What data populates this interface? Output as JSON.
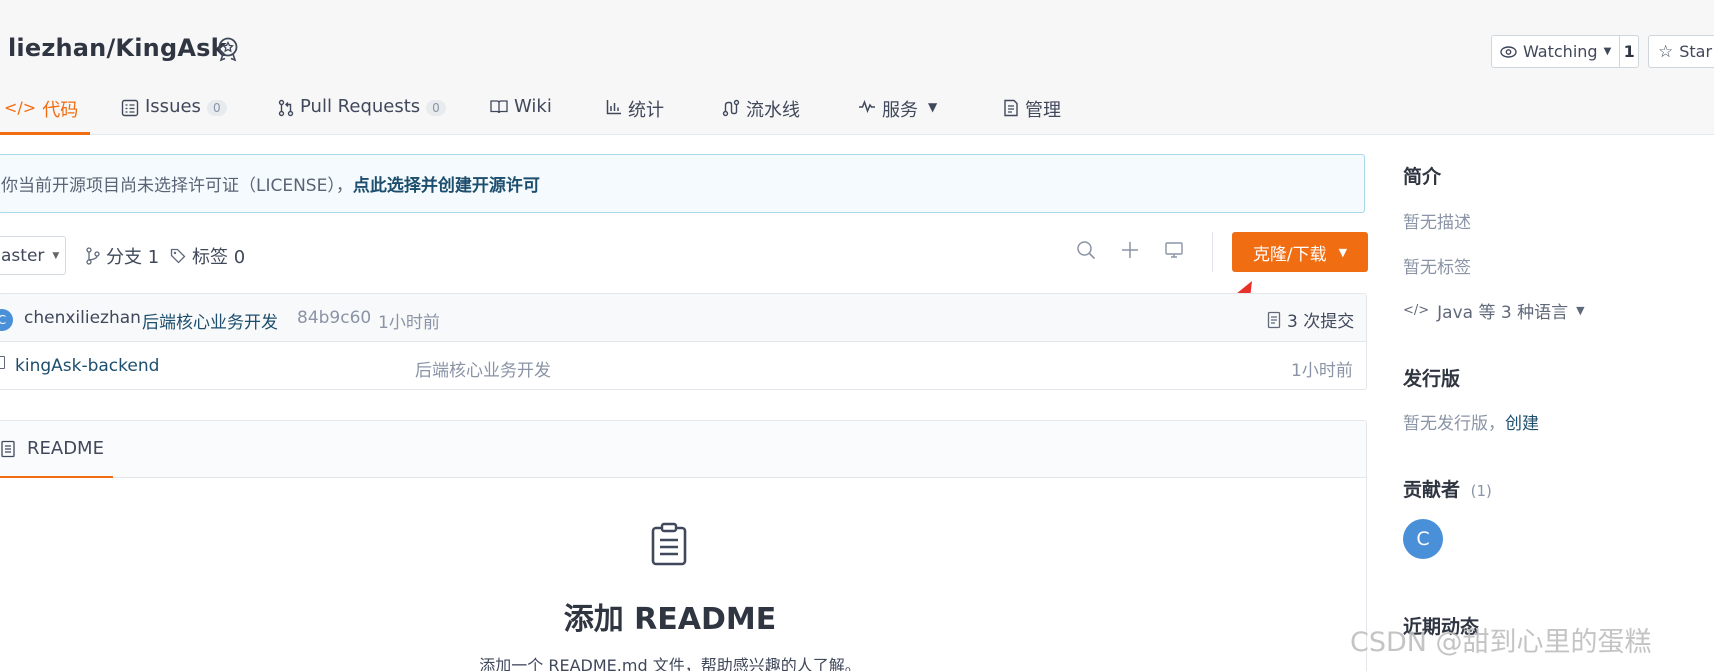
{
  "repo": {
    "title": "liezhan/KingAsk"
  },
  "watch": {
    "label": "Watching",
    "count": "1"
  },
  "star": {
    "label": "Star"
  },
  "tabs": [
    {
      "label": "代码",
      "count": null
    },
    {
      "label": "Issues",
      "count": "0"
    },
    {
      "label": "Pull Requests",
      "count": "0"
    },
    {
      "label": "Wiki",
      "count": null
    },
    {
      "label": "统计",
      "count": null
    },
    {
      "label": "流水线",
      "count": null
    },
    {
      "label": "服务",
      "count": null
    },
    {
      "label": "管理",
      "count": null
    }
  ],
  "license": {
    "text": "你当前开源项目尚未选择许可证（LICENSE），",
    "link": "点此选择并创建开源许可"
  },
  "branch": {
    "selected": "aster",
    "branches": "分支 1",
    "tags": "标签 0"
  },
  "clone_button": "克隆/下载",
  "commit": {
    "avatar_letter": "C",
    "author": "chenxiliezhan",
    "message": "后端核心业务开发",
    "hash": "84b9c60",
    "time": "1小时前",
    "count": "3 次提交"
  },
  "files": [
    {
      "name": "kingAsk-backend",
      "message": "后端核心业务开发",
      "time": "1小时前"
    }
  ],
  "readme": {
    "tab": "README",
    "title": "添加 README",
    "subtitle": "添加一个 README.md 文件，帮助感兴趣的人了解。"
  },
  "sidebar": {
    "intro_heading": "简介",
    "no_desc": "暂无描述",
    "no_tags": "暂无标签",
    "languages": "Java 等 3 种语言",
    "release_heading": "发行版",
    "no_release": "暂无发行版，",
    "create": "创建",
    "contrib_heading": "贡献者",
    "contrib_count": "(1)",
    "contrib_avatar": "C",
    "activity_heading": "近期动态"
  },
  "watermark": "CSDN @甜到心里的蛋糕",
  "colors": {
    "accent": "#f06d12",
    "link": "#1d4e6d",
    "avatar": "#4a90d9"
  }
}
